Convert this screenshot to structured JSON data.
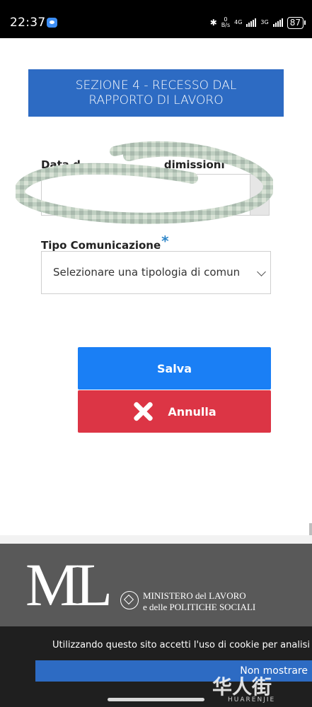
{
  "status_bar": {
    "time": "22:37",
    "speed_value": "0",
    "speed_unit": "B/s",
    "network_1": "4G",
    "network_2": "3G",
    "battery": "87"
  },
  "section": {
    "title_line1": "SEZIONE 4 - RECESSO DAL",
    "title_line2": "RAPPORTO DI LAVORO"
  },
  "form": {
    "date_label_start": "Data d",
    "date_label_end": "dimissioni",
    "tipo_label": "Tipo Comunicazione",
    "required_mark": "*",
    "tipo_selected": "Selezionare una tipologia di comunicazione"
  },
  "buttons": {
    "save_label": "Salva",
    "cancel_label": "Annulla"
  },
  "footer": {
    "logo_text": "ML",
    "ministry_line1": "MINISTERO del LAVORO",
    "ministry_line2": "e delle POLITICHE SOCIALI"
  },
  "cookie": {
    "text": "Utilizzando questo sito accetti l'uso di cookie per analisi",
    "button_label": "Non mostrare"
  },
  "watermark": {
    "main": "华人街",
    "sub": "HUARENJIE"
  },
  "colors": {
    "header_blue": "#2d6bc3",
    "save_blue": "#1a7ff5",
    "cancel_red": "#dc3545",
    "footer_gray": "#595959"
  }
}
